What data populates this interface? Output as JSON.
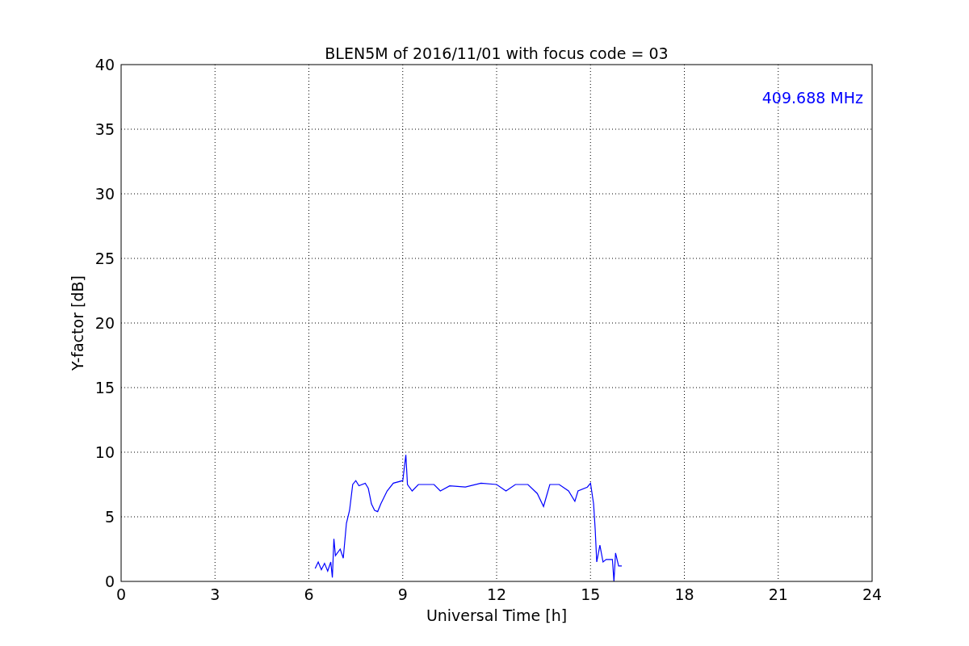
{
  "chart_data": {
    "type": "line",
    "title": "BLEN5M of 2016/11/01 with focus code = 03",
    "xlabel": "Universal Time [h]",
    "ylabel": "Y-factor [dB]",
    "x": [
      6.2,
      6.3,
      6.4,
      6.5,
      6.6,
      6.7,
      6.75,
      6.8,
      6.85,
      7.0,
      7.1,
      7.2,
      7.3,
      7.4,
      7.5,
      7.6,
      7.8,
      7.9,
      8.0,
      8.1,
      8.2,
      8.3,
      8.5,
      8.7,
      9.0,
      9.1,
      9.15,
      9.3,
      9.5,
      10.0,
      10.2,
      10.5,
      11.0,
      11.5,
      12.0,
      12.3,
      12.6,
      13.0,
      13.3,
      13.5,
      13.7,
      14.0,
      14.3,
      14.5,
      14.6,
      14.9,
      15.0,
      15.1,
      15.15,
      15.2,
      15.3,
      15.4,
      15.5,
      15.7,
      15.75,
      15.8,
      15.9,
      16.0
    ],
    "series": [
      {
        "name": "409.688 MHz",
        "color": "#0000ff",
        "values": [
          1.0,
          1.5,
          0.9,
          1.4,
          0.8,
          1.5,
          0.3,
          3.3,
          2.0,
          2.5,
          1.8,
          4.5,
          5.5,
          7.5,
          7.8,
          7.4,
          7.6,
          7.2,
          6.0,
          5.5,
          5.4,
          6.0,
          7.0,
          7.6,
          7.8,
          9.8,
          7.5,
          7.0,
          7.5,
          7.5,
          7.0,
          7.4,
          7.3,
          7.6,
          7.5,
          7.0,
          7.5,
          7.5,
          6.8,
          5.8,
          7.5,
          7.5,
          7.0,
          6.2,
          7.0,
          7.3,
          7.6,
          6.0,
          4.0,
          1.5,
          2.8,
          1.5,
          1.7,
          1.7,
          0.0,
          2.2,
          1.2,
          1.2
        ]
      }
    ],
    "xlim": [
      0,
      24
    ],
    "ylim": [
      0,
      40
    ],
    "xticks": [
      0,
      3,
      6,
      9,
      12,
      15,
      18,
      21,
      24
    ],
    "yticks": [
      0,
      5,
      10,
      15,
      20,
      25,
      30,
      35,
      40
    ],
    "grid": true
  }
}
